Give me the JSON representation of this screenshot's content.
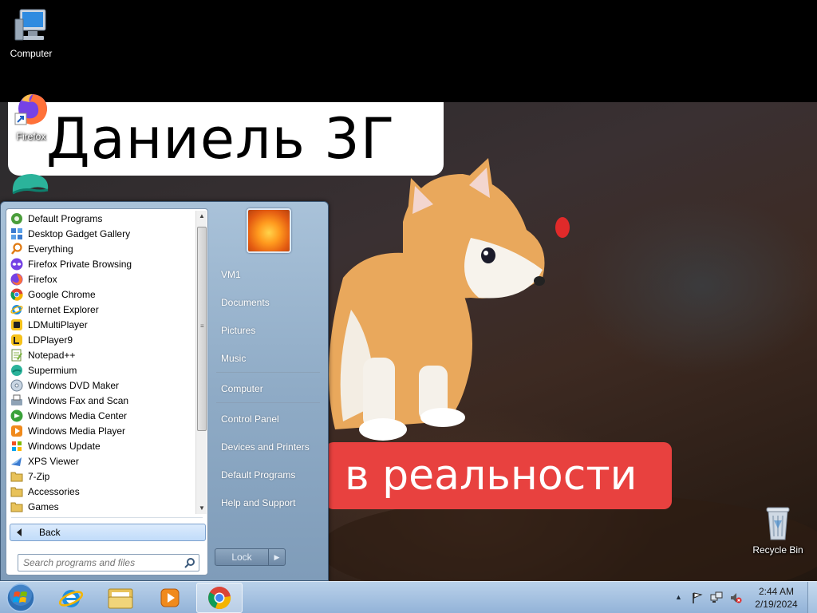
{
  "wallpaper": {
    "title": "Даниель 3Г",
    "caption": "в реальности"
  },
  "desktop_icons": {
    "computer": "Computer",
    "firefox": "Firefox",
    "recycle_bin": "Recycle Bin"
  },
  "start_menu": {
    "programs": [
      {
        "label": "Default Programs",
        "icon": "default-programs-icon"
      },
      {
        "label": "Desktop Gadget Gallery",
        "icon": "gadget-gallery-icon"
      },
      {
        "label": "Everything",
        "icon": "everything-icon"
      },
      {
        "label": "Firefox Private Browsing",
        "icon": "firefox-private-icon"
      },
      {
        "label": "Firefox",
        "icon": "firefox-icon"
      },
      {
        "label": "Google Chrome",
        "icon": "chrome-icon"
      },
      {
        "label": "Internet Explorer",
        "icon": "internet-explorer-icon"
      },
      {
        "label": "LDMultiPlayer",
        "icon": "ldmultiplayer-icon"
      },
      {
        "label": "LDPlayer9",
        "icon": "ldplayer-icon"
      },
      {
        "label": "Notepad++",
        "icon": "notepadpp-icon"
      },
      {
        "label": "Supermium",
        "icon": "supermium-icon"
      },
      {
        "label": "Windows DVD Maker",
        "icon": "dvd-maker-icon"
      },
      {
        "label": "Windows Fax and Scan",
        "icon": "fax-scan-icon"
      },
      {
        "label": "Windows Media Center",
        "icon": "media-center-icon"
      },
      {
        "label": "Windows Media Player",
        "icon": "media-player-icon"
      },
      {
        "label": "Windows Update",
        "icon": "windows-update-icon"
      },
      {
        "label": "XPS Viewer",
        "icon": "xps-viewer-icon"
      },
      {
        "label": "7-Zip",
        "icon": "folder-icon"
      },
      {
        "label": "Accessories",
        "icon": "folder-icon"
      },
      {
        "label": "Games",
        "icon": "folder-icon"
      }
    ],
    "back_label": "Back",
    "search_placeholder": "Search programs and files",
    "right_links": [
      "VM1",
      "Documents",
      "Pictures",
      "Music",
      "Computer",
      "Control Panel",
      "Devices and Printers",
      "Default Programs",
      "Help and Support"
    ],
    "lock_label": "Lock"
  },
  "taskbar": {
    "pinned": [
      "internet-explorer-icon",
      "explorer-folder-icon",
      "media-player-icon",
      "chrome-icon"
    ],
    "active": "chrome-icon"
  },
  "tray": {
    "time": "2:44 AM",
    "date": "2/19/2024"
  }
}
